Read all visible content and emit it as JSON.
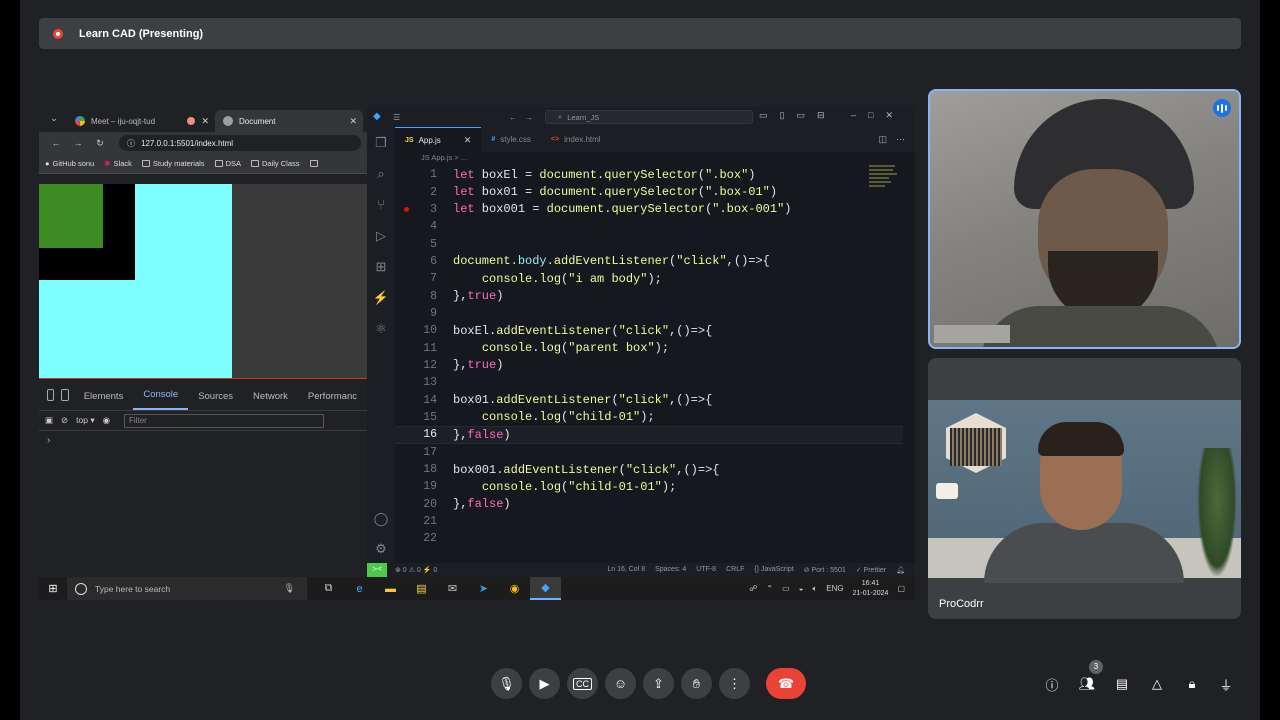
{
  "meet": {
    "presenting_title": "Learn CAD (Presenting)",
    "participant_count": "3",
    "participant_name": "ProCodrr"
  },
  "browser": {
    "tabs": [
      {
        "label": "Meet – iju-oqjt-tud"
      },
      {
        "label": "Document"
      }
    ],
    "url": "127.0.0.1:5501/index.html",
    "bookmarks": [
      "GitHub sonu",
      "Slack",
      "Study materials",
      "DSA",
      "Daily Class"
    ],
    "devtools": {
      "tabs": [
        "Elements",
        "Console",
        "Sources",
        "Network",
        "Performanc"
      ],
      "context": "top",
      "filter_placeholder": "Filter",
      "prompt": "›"
    }
  },
  "vscode": {
    "search": "Learn_JS",
    "tabs": [
      {
        "lang": "JS",
        "label": "App.js"
      },
      {
        "lang": "#",
        "label": "style.css"
      },
      {
        "lang": "<>",
        "label": "index.html"
      }
    ],
    "breadcrumb": "JS App.js > ...",
    "current_line": 16,
    "breakpoint_line": 3,
    "code_lines": [
      "let boxEl = document.querySelector(\".box\")",
      "let box01 = document.querySelector(\".box-01\")",
      "let box001 = document.querySelector(\".box-001\")",
      "",
      "",
      "document.body.addEventListener(\"click\",()=>{",
      "    console.log(\"i am body\");",
      "},true)",
      "",
      "boxEl.addEventListener(\"click\",()=>{",
      "    console.log(\"parent box\");",
      "},true)",
      "",
      "box01.addEventListener(\"click\",()=>{",
      "    console.log(\"child-01\");",
      "},false)",
      "",
      "box001.addEventListener(\"click\",()=>{",
      "    console.log(\"child-01-01\");",
      "},false)",
      "",
      ""
    ],
    "status": {
      "problems": "⊗ 0 ⚠ 0 ⚡ 0",
      "position": "Ln 16, Col 8",
      "spaces": "Spaces: 4",
      "encoding": "UTF-8",
      "eol": "CRLF",
      "language": "{} JavaScript",
      "port": "⊘ Port : 5501",
      "prettier": "✓ Prettier"
    }
  },
  "taskbar": {
    "search_placeholder": "Type here to search",
    "lang": "ENG",
    "time": "16:41",
    "date": "21-01-2024"
  }
}
